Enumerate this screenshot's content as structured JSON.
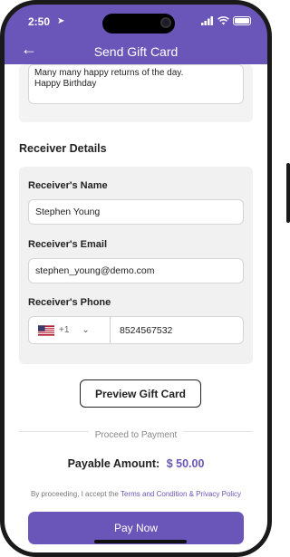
{
  "status_bar": {
    "time": "2:50"
  },
  "nav": {
    "title": "Send Gift Card"
  },
  "message": {
    "text_line1": "Many many happy returns of the day.",
    "text_line2": "Happy Birthday"
  },
  "receiver": {
    "section_title": "Receiver Details",
    "name_label": "Receiver's Name",
    "name_value": "Stephen Young",
    "email_label": "Receiver's Email",
    "email_value": "stephen_young@demo.com",
    "phone_label": "Receiver's Phone",
    "country_code": "+1",
    "country_flag": "us-flag-icon",
    "phone_value": "8524567532"
  },
  "preview_button": "Preview Gift Card",
  "divider_label": "Proceed to Payment",
  "payable": {
    "label": "Payable Amount:",
    "amount": "$ 50.00"
  },
  "terms": {
    "prefix": "By proceeding, I accept the ",
    "link": "Terms and Condition & Privacy Policy"
  },
  "pay_button": "Pay Now",
  "colors": {
    "accent": "#6a55b8",
    "card_bg": "#f1f1f1",
    "text": "#222222"
  }
}
